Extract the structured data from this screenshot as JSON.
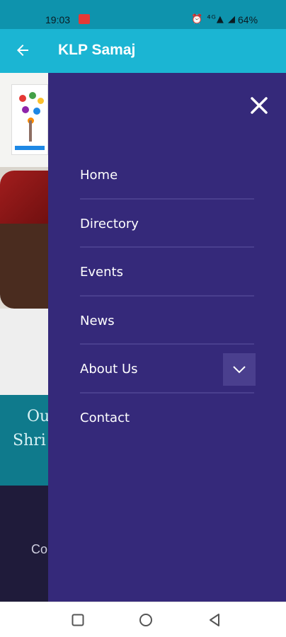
{
  "status_bar": {
    "time": "19:03",
    "icons": "⏰ ⁴ᴳ▲ ◢",
    "battery": "64%"
  },
  "app_bar": {
    "title": "KLP Samaj"
  },
  "background_page": {
    "band_line1": "Ou",
    "band_line2": "Shri",
    "dark_text": "Co"
  },
  "drawer": {
    "menu": [
      {
        "label": "Home"
      },
      {
        "label": "Directory"
      },
      {
        "label": "Events"
      },
      {
        "label": "News"
      },
      {
        "label": "About Us",
        "expandable": true
      },
      {
        "label": "Contact"
      }
    ]
  },
  "colors": {
    "status_bar": "#0e93ad",
    "app_bar": "#1bb5d3",
    "drawer": "#35297a",
    "divider": "#4a3f8e"
  }
}
